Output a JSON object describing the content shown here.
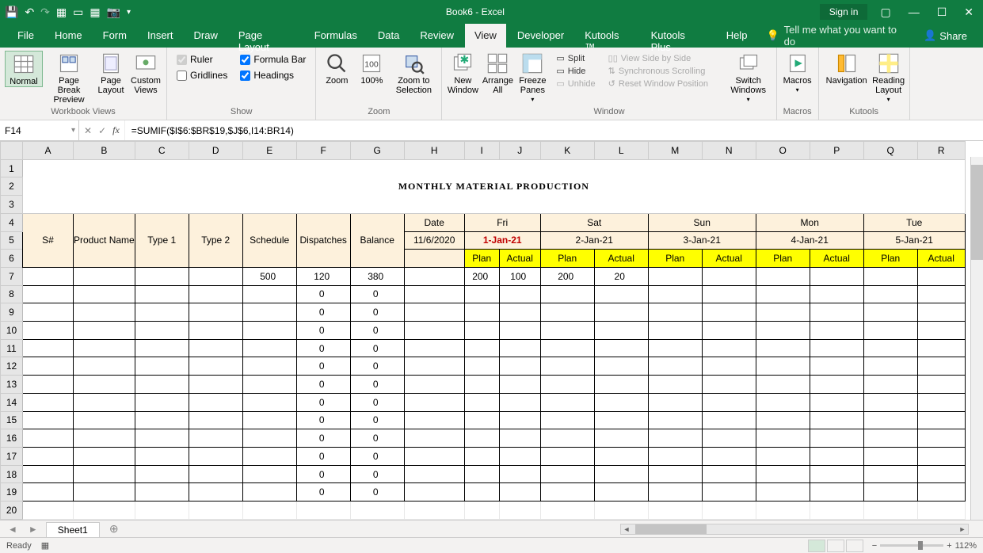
{
  "app": {
    "title": "Book6 - Excel",
    "signin": "Sign in"
  },
  "tabs": {
    "file": "File",
    "home": "Home",
    "form": "Form",
    "insert": "Insert",
    "draw": "Draw",
    "pagelayout": "Page Layout",
    "formulas": "Formulas",
    "data": "Data",
    "review": "Review",
    "view": "View",
    "developer": "Developer",
    "kutools": "Kutools ™",
    "kutoolsplus": "Kutools Plus",
    "help": "Help",
    "tellme": "Tell me what you want to do",
    "share": "Share"
  },
  "ribbon": {
    "views": {
      "label": "Workbook Views",
      "normal": "Normal",
      "pbp": "Page Break Preview",
      "pl": "Page Layout",
      "cv": "Custom Views"
    },
    "show": {
      "label": "Show",
      "ruler": "Ruler",
      "gridlines": "Gridlines",
      "formulabar": "Formula Bar",
      "headings": "Headings"
    },
    "zoom": {
      "label": "Zoom",
      "zoom": "Zoom",
      "z100": "100%",
      "zsel": "Zoom to Selection"
    },
    "window": {
      "label": "Window",
      "neww": "New Window",
      "arrange": "Arrange All",
      "freeze": "Freeze Panes",
      "split": "Split",
      "hide": "Hide",
      "unhide": "Unhide",
      "sbs": "View Side by Side",
      "sync": "Synchronous Scrolling",
      "reset": "Reset Window Position",
      "switch": "Switch Windows"
    },
    "macros": {
      "label": "Macros",
      "macros": "Macros"
    },
    "kutools": {
      "label": "Kutools",
      "nav": "Navigation",
      "rl": "Reading Layout"
    }
  },
  "fbar": {
    "name": "F14",
    "formula": "=SUMIF($I$6:$BR$19,$J$6,I14:BR14)"
  },
  "cols": [
    "A",
    "B",
    "C",
    "D",
    "E",
    "F",
    "G",
    "H",
    "I",
    "J",
    "K",
    "L",
    "M",
    "N",
    "O",
    "P",
    "Q",
    "R"
  ],
  "rows": [
    "1",
    "2",
    "3",
    "4",
    "5",
    "6",
    "7",
    "8",
    "9",
    "10",
    "11",
    "12",
    "13",
    "14",
    "15",
    "16",
    "17",
    "18",
    "19",
    "20"
  ],
  "sheet": {
    "title": "MONTHLY MATERIAL PRODUCTION",
    "hdr": {
      "sno": "S#",
      "pname": "Product Name",
      "t1": "Type 1",
      "t2": "Type 2",
      "sched": "Schedule",
      "disp": "Dispatches",
      "bal": "Balance",
      "date": "Date",
      "plan": "Plan",
      "actual": "Actual"
    },
    "dates": {
      "start": "11/6/2020",
      "days": [
        {
          "dow": "Fri",
          "d": "1-Jan-21",
          "today": true
        },
        {
          "dow": "Sat",
          "d": "2-Jan-21",
          "today": false
        },
        {
          "dow": "Sun",
          "d": "3-Jan-21",
          "today": false
        },
        {
          "dow": "Mon",
          "d": "4-Jan-21",
          "today": false
        },
        {
          "dow": "Tue",
          "d": "5-Jan-21",
          "today": false
        }
      ]
    },
    "data": [
      {
        "sched": "500",
        "disp": "120",
        "bal": "380",
        "p1": "200",
        "a1": "100",
        "p2": "200",
        "a2": "20"
      },
      {
        "disp": "0",
        "bal": "0"
      },
      {
        "disp": "0",
        "bal": "0"
      },
      {
        "disp": "0",
        "bal": "0"
      },
      {
        "disp": "0",
        "bal": "0"
      },
      {
        "disp": "0",
        "bal": "0"
      },
      {
        "disp": "0",
        "bal": "0"
      },
      {
        "disp": "0",
        "bal": "0"
      },
      {
        "disp": "0",
        "bal": "0"
      },
      {
        "disp": "0",
        "bal": "0"
      },
      {
        "disp": "0",
        "bal": "0"
      },
      {
        "disp": "0",
        "bal": "0"
      },
      {
        "disp": "0",
        "bal": "0"
      }
    ]
  },
  "tabsheet": {
    "name": "Sheet1"
  },
  "status": {
    "ready": "Ready",
    "zoom": "112%"
  }
}
